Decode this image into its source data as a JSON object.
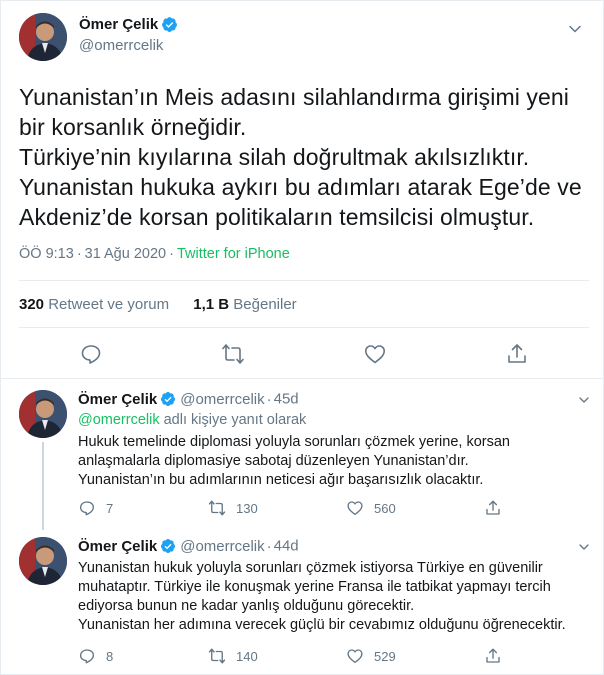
{
  "main_tweet": {
    "author": {
      "name": "Ömer Çelik",
      "handle": "@omerrcelik",
      "verified": true
    },
    "text_lines": [
      "Yunanistan’ın Meis adasını silahlandırma girişimi yeni",
      "bir korsanlık örneğidir.",
      "Türkiye’nin kıyılarına silah doğrultmak akılsızlıktır.",
      "Yunanistan hukuka aykırı bu adımları atarak Ege’de ve",
      "Akdeniz’de korsan politikaların temsilcisi olmuştur."
    ],
    "time": "ÖÖ 9:13",
    "separator": "·",
    "date": "31 Ağu 2020",
    "source": "Twitter for iPhone",
    "stats": {
      "retweets_count": "320",
      "retweets_label": "Retweet ve yorum",
      "likes_count": "1,1 B",
      "likes_label": "Beğeniler"
    },
    "action_icons": [
      "reply-icon",
      "retweet-icon",
      "like-icon",
      "share-icon"
    ]
  },
  "replies": [
    {
      "author": {
        "name": "Ömer Çelik",
        "handle": "@omerrcelik",
        "verified": true
      },
      "dot": "·",
      "time": "45d",
      "reply_to": {
        "mention": "@omerrcelik",
        "suffix": " adlı kişiye yanıt olarak"
      },
      "text_lines": [
        "Hukuk temelinde diplomasi yoluyla sorunları çözmek yerine, korsan",
        "anlaşmalarla diplomasiye sabotaj düzenleyen Yunanistan’dır.",
        "Yunanistan’ın bu adımlarının neticesi  ağır başarısızlık olacaktır."
      ],
      "counts": {
        "reply": "7",
        "retweet": "130",
        "like": "560"
      }
    },
    {
      "author": {
        "name": "Ömer Çelik",
        "handle": "@omerrcelik",
        "verified": true
      },
      "dot": "·",
      "time": "44d",
      "text_lines": [
        "Yunanistan hukuk yoluyla sorunları çözmek istiyorsa Türkiye en güvenilir",
        "muhataptır. Türkiye ile konuşmak  yerine Fransa ile tatbikat yapmayı tercih",
        "ediyorsa bunun ne kadar yanlış olduğunu görecektir.",
        "Yunanistan her adımına verecek güçlü bir cevabımız olduğunu öğrenecektir."
      ],
      "counts": {
        "reply": "8",
        "retweet": "140",
        "like": "529"
      }
    }
  ],
  "colors": {
    "text": "#14171a",
    "secondary": "#657786",
    "accent_green": "#17bf63",
    "verified_blue": "#1da1f2",
    "divider": "#e6ecf0"
  }
}
